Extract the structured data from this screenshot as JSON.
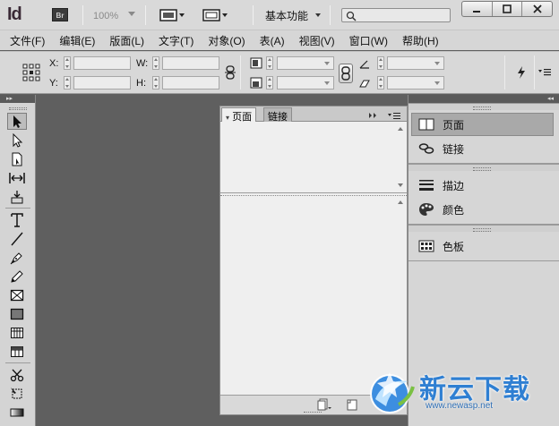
{
  "app": {
    "logo": "Id",
    "bridge": "Br",
    "zoom": "100%",
    "workspace": "基本功能"
  },
  "menus": [
    "文件(F)",
    "编辑(E)",
    "版面(L)",
    "文字(T)",
    "对象(O)",
    "表(A)",
    "视图(V)",
    "窗口(W)",
    "帮助(H)"
  ],
  "controls": {
    "x_label": "X:",
    "y_label": "Y:",
    "w_label": "W:",
    "h_label": "H:"
  },
  "float_panel": {
    "tabs": [
      "页面",
      "链接"
    ]
  },
  "dock": {
    "items": [
      {
        "label": "页面",
        "icon": "pages-icon"
      },
      {
        "label": "链接",
        "icon": "links-icon"
      },
      {
        "label": "描边",
        "icon": "stroke-icon"
      },
      {
        "label": "颜色",
        "icon": "color-icon"
      },
      {
        "label": "色板",
        "icon": "swatches-icon"
      }
    ]
  },
  "watermark": {
    "name": "新云下载",
    "url": "www.newasp.net"
  },
  "colors": {
    "pasteboard": "#5f5f5f",
    "panel_bg": "#d6d6d6",
    "watermark_blue": "#2f7fd2"
  }
}
